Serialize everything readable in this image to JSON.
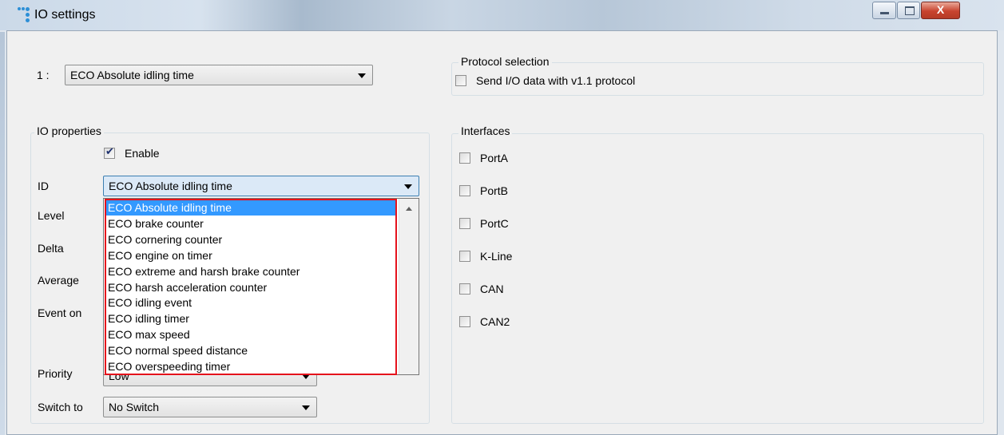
{
  "window": {
    "title": "IO settings"
  },
  "window_controls": {
    "close_symbol": "X"
  },
  "io_selector": {
    "index_label": "1 :",
    "value": "ECO Absolute idling time"
  },
  "protocol": {
    "group_title": "Protocol selection",
    "v11_label": "Send I/O data with v1.1 protocol",
    "v11_checked": false
  },
  "io_properties": {
    "group_title": "IO properties",
    "enable_label": "Enable",
    "enable_checked": true,
    "id_label": "ID",
    "id_value": "ECO Absolute idling time",
    "level_label": "Level",
    "delta_label": "Delta",
    "average_label": "Average",
    "event_on_label": "Event on",
    "priority_label": "Priority",
    "priority_value": "Low",
    "switch_to_label": "Switch to",
    "switch_to_value": "No Switch"
  },
  "id_dropdown": {
    "options": [
      "ECO Absolute idling time",
      "ECO brake counter",
      "ECO cornering counter",
      "ECO engine on timer",
      "ECO extreme and harsh brake counter",
      "ECO harsh acceleration counter",
      "ECO idling event",
      "ECO idling timer",
      "ECO max speed",
      "ECO normal speed distance",
      "ECO overspeeding timer"
    ],
    "selected_index": 0
  },
  "interfaces": {
    "group_title": "Interfaces",
    "items": [
      {
        "label": "PortA",
        "checked": false
      },
      {
        "label": "PortB",
        "checked": false
      },
      {
        "label": "PortC",
        "checked": false
      },
      {
        "label": "K-Line",
        "checked": false
      },
      {
        "label": "CAN",
        "checked": false
      },
      {
        "label": "CAN2",
        "checked": false
      }
    ]
  },
  "colors": {
    "highlight_border": "#e5121c",
    "selection": "#3399ff"
  }
}
